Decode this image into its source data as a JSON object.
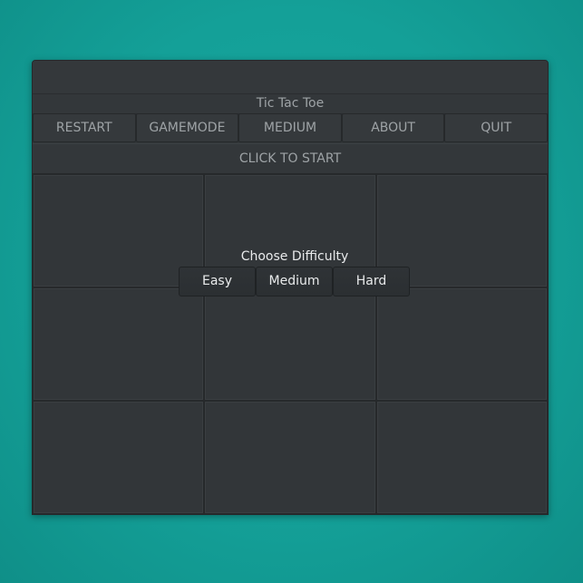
{
  "window": {
    "app_title": "Tic Tac Toe",
    "menu": [
      {
        "label": "RESTART"
      },
      {
        "label": "GAMEMODE"
      },
      {
        "label": "MEDIUM"
      },
      {
        "label": "ABOUT"
      },
      {
        "label": "QUIT"
      }
    ],
    "status": "CLICK TO START"
  },
  "difficulty_dialog": {
    "title": "Choose Difficulty",
    "options": [
      {
        "label": "Easy"
      },
      {
        "label": "Medium"
      },
      {
        "label": "Hard"
      }
    ]
  },
  "board": {
    "rows": 3,
    "cols": 3,
    "cells": [
      "",
      "",
      "",
      "",
      "",
      "",
      "",
      "",
      ""
    ]
  },
  "colors": {
    "desktop": "#14a098",
    "window": "#33373a",
    "text_muted": "#9ea3a6",
    "text_light": "#e8eaeb"
  }
}
